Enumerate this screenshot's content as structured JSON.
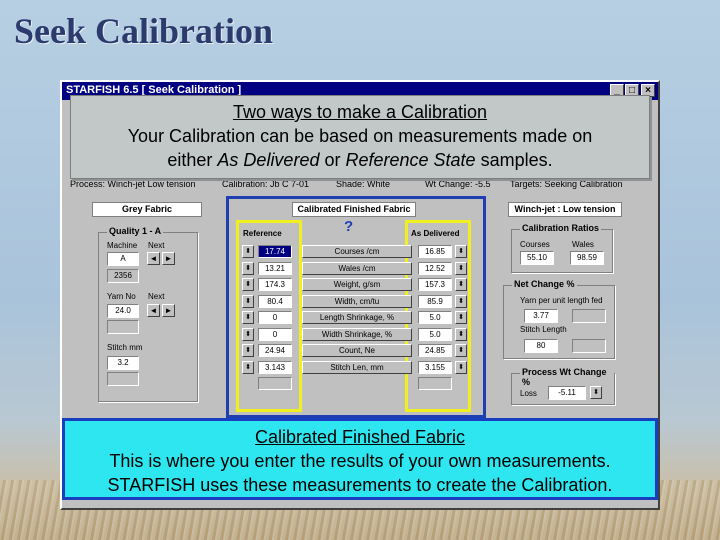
{
  "slide": {
    "title": "Seek Calibration"
  },
  "window": {
    "title": "STARFISH 6.5    [ Seek Calibration ]",
    "minimize": "_",
    "maximize": "□",
    "close": "×"
  },
  "infobar": {
    "process": "Process: Winch-jet   Low tension",
    "calibration": "Calibration: Jb C 7-01",
    "shade": "Shade: White",
    "wt_change": "Wt Change: -5.5",
    "targets": "Targets: Seeking Calibration"
  },
  "left_panel": {
    "header": "Grey Fabric",
    "quality_label": "Quality 1 - A",
    "machine_label": "Machine",
    "next_label": "Next",
    "machine_value": "A",
    "machine_number": "2356",
    "yarn_label": "Yarn No",
    "yarn_next_label": "Next",
    "yarn_value": "24.0",
    "stitch_label": "Stitch mm",
    "stitch_value": "3.2"
  },
  "center_panel": {
    "header": "Calibrated Finished Fabric",
    "reference_label": "Reference",
    "as_delivered_label": "As Delivered",
    "rows": [
      {
        "label": "Courses /cm",
        "reference": "17.74",
        "delivered": "16.85"
      },
      {
        "label": "Wales /cm",
        "reference": "13.21",
        "delivered": "12.52"
      },
      {
        "label": "Weight, g/sm",
        "reference": "174.3",
        "delivered": "157.3"
      },
      {
        "label": "Width, cm/tu",
        "reference": "80.4",
        "delivered": "85.9"
      },
      {
        "label": "Length Shrinkage, %",
        "reference": "0",
        "delivered": "5.0"
      },
      {
        "label": "Width Shrinkage, %",
        "reference": "0",
        "delivered": "5.0"
      },
      {
        "label": "Count, Ne",
        "reference": "24.94",
        "delivered": "24.85"
      },
      {
        "label": "Stitch Len, mm",
        "reference": "3.143",
        "delivered": "3.155"
      }
    ]
  },
  "right_panel": {
    "header": "Winch-jet : Low tension",
    "ratios_label": "Calibration Ratios",
    "courses_label": "Courses",
    "wales_label": "Wales",
    "courses_value": "55.10",
    "wales_value": "98.59",
    "net_change_label": "Net Change %",
    "yarn_per_unit_label": "Yarn per unit length fed",
    "yarn_per_unit_value": "3.77",
    "stitch_length_label": "Stitch Length",
    "stitch_length_value": "80",
    "process_wt_label": "Process Wt Change %",
    "loss_label": "Loss",
    "loss_value": "-5.11"
  },
  "callouts": {
    "top": {
      "title": "Two ways to make a Calibration",
      "line1": "Your Calibration can be based on measurements made on",
      "line2_a": "either ",
      "line2_b": "As Delivered",
      "line2_c": " or ",
      "line2_d": "Reference State",
      "line2_e": " samples."
    },
    "bottom": {
      "title": "Calibrated Finished Fabric",
      "line1": "This is where you enter the results of your own measurements.",
      "line2": "STARFISH uses these measurements to create the Calibration."
    }
  },
  "colors": {
    "title_color": "#2b3b6e",
    "window_bg": "#c0c0c0",
    "titlebar": "#000080",
    "highlight_yellow": "#f0f020",
    "highlight_blue": "#1f3fb0",
    "bottom_callout": "#2ee6f0"
  },
  "icons": {
    "help": "help-pointer-icon",
    "spin": "spin-arrows-icon"
  }
}
